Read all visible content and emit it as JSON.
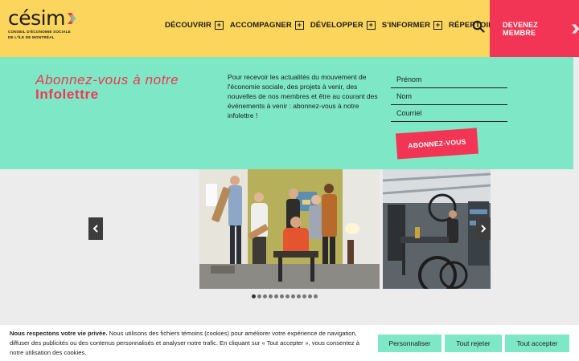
{
  "header": {
    "logo_word": "césim",
    "logo_sub_line1": "CONSEIL D'ÉCONOMIE SOCIALE",
    "logo_sub_line2": "DE L'ÎLE DE MONTRÉAL",
    "nav": [
      {
        "label": "DÉCOUVRIR",
        "plus": "+"
      },
      {
        "label": "ACCOMPAGNER",
        "plus": "+"
      },
      {
        "label": "DÉVELOPPER",
        "plus": "+"
      },
      {
        "label": "S'INFORMER",
        "plus": "+"
      },
      {
        "label": "RÉPERTOIRE",
        "plus": ""
      }
    ],
    "member_button": "DEVENEZ MEMBRE",
    "colors": {
      "header_bg": "#fcd55c",
      "accent": "#f23554"
    }
  },
  "newsletter": {
    "title_line1": "Abonnez-vous à notre",
    "title_line2": "Infolettre",
    "description": "Pour recevoir les actualités du mouvement de l'économie sociale, des projets à venir, des nouvelles de nos membres et être au courant des événements à venir : abonnez-vous à notre infolettre !",
    "fields": [
      {
        "placeholder": "Prénom",
        "value": ""
      },
      {
        "placeholder": "Nom",
        "value": ""
      },
      {
        "placeholder": "Courriel",
        "value": ""
      }
    ],
    "submit_label": "ABONNEZ-VOUS",
    "bg_color": "#7ee8c6"
  },
  "carousel": {
    "prev_icon": "chevron-left-icon",
    "next_icon": "chevron-right-icon",
    "slide_count": 12,
    "active_index": 0
  },
  "cookie_banner": {
    "bold_lead": "Nous respectons votre vie privée.",
    "text": " Nous utilisons des fichiers témoins (cookies) pour améliorer votre expérience de navigation, diffuser des publicités ou des contenus personnalisés et analyser notre trafic. En cliquant sur « Tout accepter », vous consentez à notre utilisation des cookies.",
    "buttons": {
      "customize": "Personnaliser",
      "reject": "Tout rejeter",
      "accept": "Tout accepter"
    }
  }
}
